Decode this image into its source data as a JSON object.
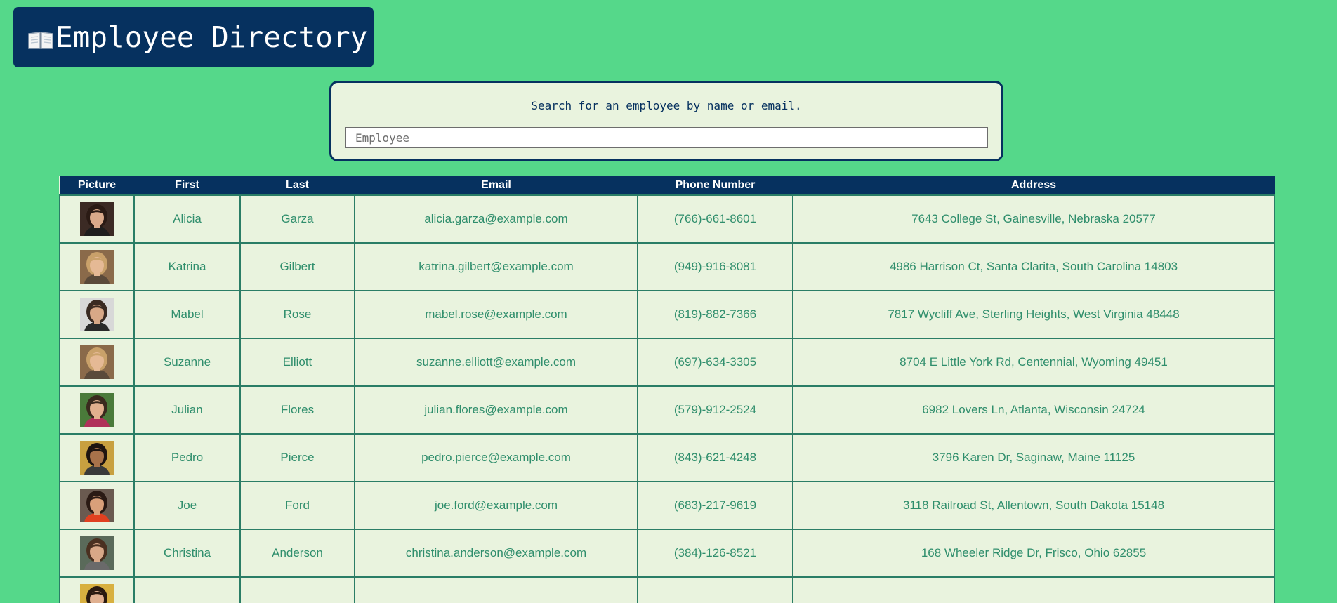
{
  "header": {
    "icon": "open-book-icon",
    "title": "Employee Directory"
  },
  "search": {
    "prompt": "Search for an employee by name or email.",
    "placeholder": "Employee",
    "value": ""
  },
  "table": {
    "columns": [
      "Picture",
      "First",
      "Last",
      "Email",
      "Phone Number",
      "Address"
    ],
    "rows": [
      {
        "avatar": {
          "bg": "#3b2a24",
          "skin": "#d9a98a",
          "hair": "#2a1a14",
          "shirt": "#1e1e1e"
        },
        "first": "Alicia",
        "last": "Garza",
        "email": "alicia.garza@example.com",
        "phone": "(766)-661-8601",
        "address": "7643 College St, Gainesville, Nebraska 20577"
      },
      {
        "avatar": {
          "bg": "#8a6a4a",
          "skin": "#e5b995",
          "hair": "#c9a16a",
          "shirt": "#5a4a3a"
        },
        "first": "Katrina",
        "last": "Gilbert",
        "email": "katrina.gilbert@example.com",
        "phone": "(949)-916-8081",
        "address": "4986 Harrison Ct, Santa Clarita, South Carolina 14803"
      },
      {
        "avatar": {
          "bg": "#d8d8d8",
          "skin": "#d8a887",
          "hair": "#3a2a22",
          "shirt": "#2a2a2a"
        },
        "first": "Mabel",
        "last": "Rose",
        "email": "mabel.rose@example.com",
        "phone": "(819)-882-7366",
        "address": "7817 Wycliff Ave, Sterling Heights, West Virginia 48448"
      },
      {
        "avatar": {
          "bg": "#8a6a4a",
          "skin": "#e5b995",
          "hair": "#c9a16a",
          "shirt": "#5a4a3a"
        },
        "first": "Suzanne",
        "last": "Elliott",
        "email": "suzanne.elliott@example.com",
        "phone": "(697)-634-3305",
        "address": "8704 E Little York Rd, Centennial, Wyoming 49451"
      },
      {
        "avatar": {
          "bg": "#4a7a3a",
          "skin": "#e2b08e",
          "hair": "#3a2a1e",
          "shirt": "#b0305a"
        },
        "first": "Julian",
        "last": "Flores",
        "email": "julian.flores@example.com",
        "phone": "(579)-912-2524",
        "address": "6982 Lovers Ln, Atlanta, Wisconsin 24724"
      },
      {
        "avatar": {
          "bg": "#c8a040",
          "skin": "#a8724a",
          "hair": "#1e1410",
          "shirt": "#3a3a3a"
        },
        "first": "Pedro",
        "last": "Pierce",
        "email": "pedro.pierce@example.com",
        "phone": "(843)-621-4248",
        "address": "3796 Karen Dr, Saginaw, Maine 11125"
      },
      {
        "avatar": {
          "bg": "#6a5a50",
          "skin": "#d9a07a",
          "hair": "#2a1a14",
          "shirt": "#e04020"
        },
        "first": "Joe",
        "last": "Ford",
        "email": "joe.ford@example.com",
        "phone": "(683)-217-9619",
        "address": "3118 Railroad St, Allentown, South Dakota 15148"
      },
      {
        "avatar": {
          "bg": "#5a6a5a",
          "skin": "#d8a888",
          "hair": "#4a3020",
          "shirt": "#6a6a6a"
        },
        "first": "Christina",
        "last": "Anderson",
        "email": "christina.anderson@example.com",
        "phone": "(384)-126-8521",
        "address": "168 Wheeler Ridge Dr, Frisco, Ohio 62855"
      },
      {
        "avatar": {
          "bg": "#d8b040",
          "skin": "#e0b090",
          "hair": "#2a1a10",
          "shirt": "#3a3a3a"
        },
        "first": "",
        "last": "",
        "email": "",
        "phone": "",
        "address": ""
      }
    ]
  }
}
